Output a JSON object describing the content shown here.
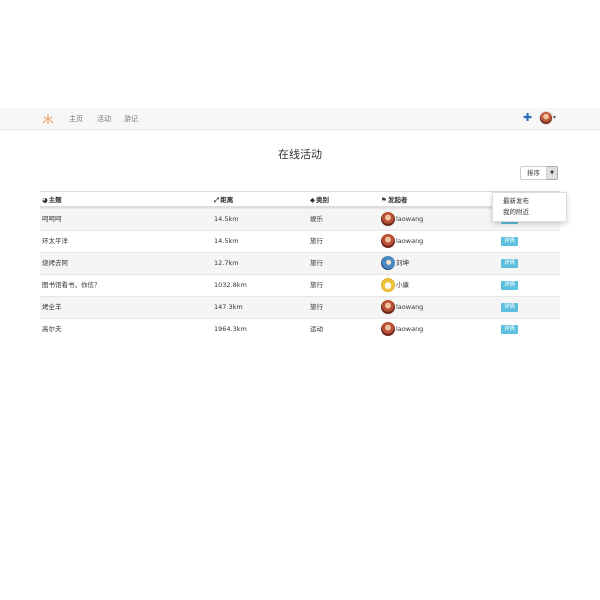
{
  "navbar": {
    "links": [
      "主页",
      "活动",
      "游记"
    ],
    "add_icon": "plus-icon",
    "avatar_icon": "user-avatar"
  },
  "page_title": "在线活动",
  "sort": {
    "label": "排序"
  },
  "dropdown": {
    "items": [
      "最新发布",
      "我的附近"
    ]
  },
  "table": {
    "headers": [
      "主题",
      "距离",
      "类别",
      "发起者"
    ],
    "header_icons": [
      "globe-icon",
      "distance-icon",
      "tag-icon",
      "user-icon"
    ],
    "rows": [
      {
        "topic": "呵呵呵",
        "distance": "14.5km",
        "category": "娱乐",
        "initiator": "laowang",
        "avatar": "avatar-laowang",
        "action": "详情"
      },
      {
        "topic": "环太平洋",
        "distance": "14.5km",
        "category": "旅行",
        "initiator": "laowang",
        "avatar": "avatar-laowang",
        "action": "详情"
      },
      {
        "topic": "烧烤去阿",
        "distance": "12.7km",
        "category": "旅行",
        "initiator": "刘坤",
        "avatar": "avatar-liukun",
        "action": "详情"
      },
      {
        "topic": "图书馆看书，你信？",
        "distance": "1032.8km",
        "category": "旅行",
        "initiator": "小康",
        "avatar": "avatar-xiaokang",
        "action": "详情"
      },
      {
        "topic": "烤全羊",
        "distance": "147.3km",
        "category": "旅行",
        "initiator": "laowang",
        "avatar": "avatar-laowang",
        "action": "详情"
      },
      {
        "topic": "高尔夫",
        "distance": "1964.3km",
        "category": "运动",
        "initiator": "laowang",
        "avatar": "avatar-laowang",
        "action": "详情"
      }
    ]
  },
  "colors": {
    "info_badge": "#5bc0de",
    "brand_logo": "#e8a06a",
    "navbar_bg": "#f7f7f7"
  }
}
